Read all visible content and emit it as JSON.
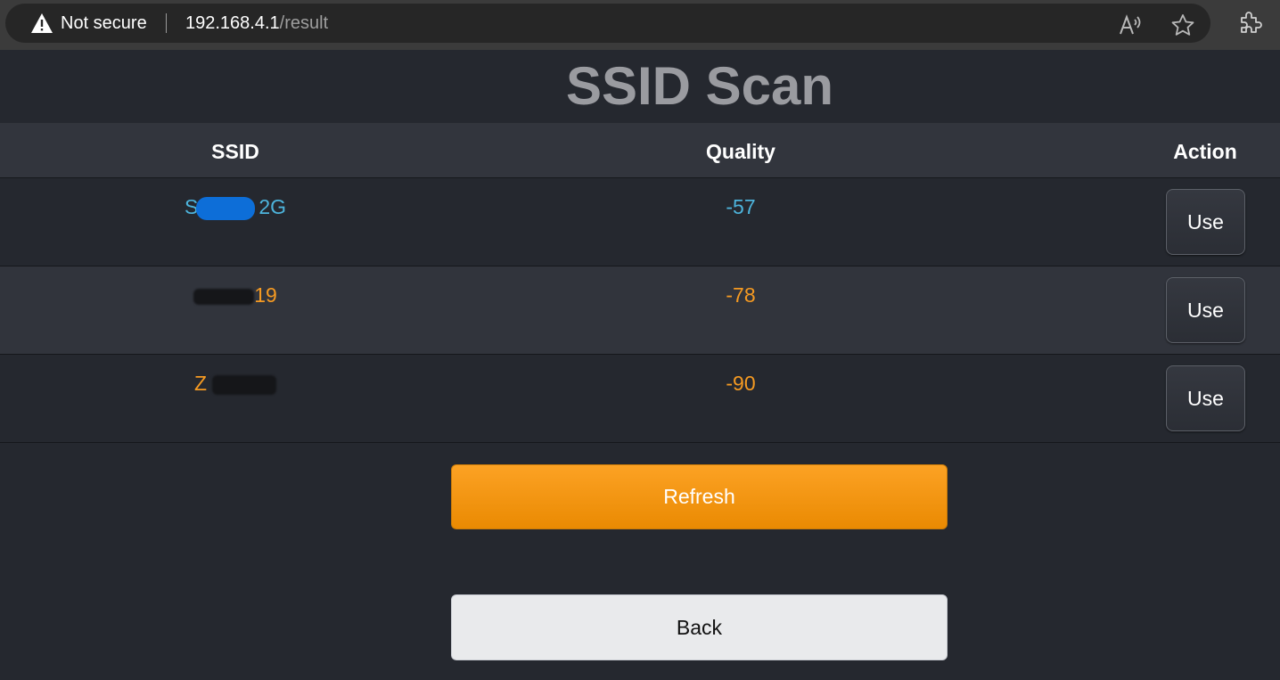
{
  "browser": {
    "security_label": "Not secure",
    "url_host": "192.168.4.1",
    "url_path": "/result"
  },
  "page": {
    "title": "SSID Scan"
  },
  "table": {
    "headers": [
      "SSID",
      "Quality",
      "Action"
    ],
    "rows": [
      {
        "ssid_prefix": "S",
        "ssid_suffix": "2G",
        "quality": "-57",
        "action": "Use",
        "status": "good"
      },
      {
        "ssid_prefix": "",
        "ssid_suffix": "19",
        "quality": "-78",
        "action": "Use",
        "status": "weak"
      },
      {
        "ssid_prefix": "Z",
        "ssid_suffix": "",
        "quality": "-90",
        "action": "Use",
        "status": "weak"
      }
    ]
  },
  "buttons": {
    "refresh": "Refresh",
    "back": "Back"
  },
  "colors": {
    "good_signal": "#4db4dc",
    "weak_signal": "#f59a22",
    "refresh_bg": "#f69412",
    "page_bg": "#25282f"
  }
}
